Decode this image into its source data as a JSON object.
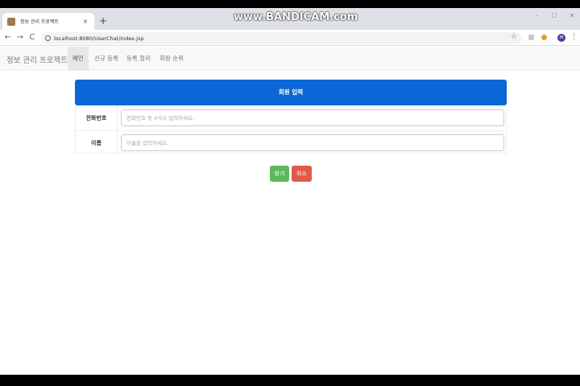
{
  "browser": {
    "tab_title": "정보 관리 프로젝트",
    "tab_close": "×",
    "new_tab": "+",
    "url": "localhost:8080/UserChat/index.jsp",
    "watermark": "www.BANDICAM.com",
    "nav": {
      "back": "←",
      "forward": "→",
      "reload": "C"
    },
    "window_controls": {
      "minimize": "–",
      "maximize": "☐",
      "close": "✕"
    },
    "star": "☆",
    "avatar": "M",
    "menu": "⋮"
  },
  "navbar": {
    "brand": "정보 관리 프로젝트",
    "links": [
      "메인",
      "신규 등록",
      "등록 정리",
      "회원 순위"
    ],
    "active": "메인"
  },
  "panel": {
    "title": "회원 입력"
  },
  "form": {
    "phone": {
      "label": "전화번호",
      "placeholder": "전화번호 뒷 4자리 입력하세요."
    },
    "name": {
      "label": "이름",
      "placeholder": "이름을 입력하세요."
    }
  },
  "buttons": {
    "save": "찾기",
    "cancel": "취소"
  },
  "colors": {
    "primary": "#0b67d5",
    "success": "#5cb85c",
    "danger": "#e05a47"
  }
}
